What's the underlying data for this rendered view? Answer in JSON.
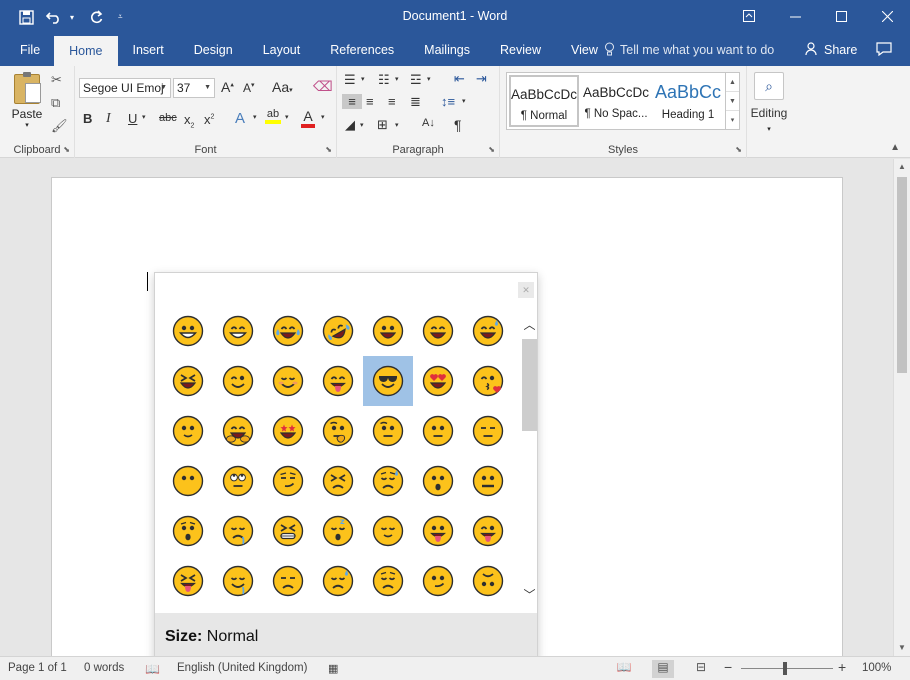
{
  "titlebar": {
    "title": "Document1 - Word",
    "qat": {
      "save_icon": "save-icon",
      "undo_icon": "undo-icon",
      "redo_icon": "redo-icon"
    }
  },
  "tabs": [
    "File",
    "Home",
    "Insert",
    "Design",
    "Layout",
    "References",
    "Mailings",
    "Review",
    "View"
  ],
  "active_tab": "Home",
  "tell_me": "Tell me what you want to do",
  "share": "Share",
  "ribbon": {
    "clipboard": {
      "label": "Clipboard",
      "paste": "Paste"
    },
    "font": {
      "label": "Font",
      "name": "Segoe UI Emoj",
      "size": "37"
    },
    "paragraph": {
      "label": "Paragraph"
    },
    "styles": {
      "label": "Styles",
      "items": [
        {
          "sample": "AaBbCcDc",
          "name": "¶ Normal"
        },
        {
          "sample": "AaBbCcDc",
          "name": "¶ No Spac..."
        },
        {
          "sample": "AaBbCc",
          "name": "Heading 1"
        }
      ]
    },
    "editing": {
      "label": "Editing"
    }
  },
  "emoji_panel": {
    "size_label": "Size:",
    "size_value": "Normal",
    "selected_index": 11,
    "emojis": [
      "grinning",
      "grin",
      "joy",
      "rofl",
      "smiley",
      "smile",
      "sweat-smile",
      "laughing",
      "wink",
      "blush",
      "yum",
      "sunglasses",
      "heart-eyes",
      "kissing-heart",
      "slight-smile",
      "hugging",
      "star-struck",
      "thinking",
      "raised-brow",
      "neutral",
      "expressionless",
      "no-mouth",
      "eye-roll",
      "smirk",
      "persevere",
      "disappointed-relieved",
      "open-mouth",
      "zipper",
      "hushed",
      "sleepy",
      "tired",
      "sleeping",
      "relieved",
      "tongue",
      "tongue-wink",
      "tongue-squint",
      "drooling",
      "unamused",
      "sweat",
      "pensive",
      "confused",
      "upside-down"
    ]
  },
  "statusbar": {
    "page": "Page 1 of 1",
    "words": "0 words",
    "language": "English (United Kingdom)",
    "zoom": "100%"
  }
}
